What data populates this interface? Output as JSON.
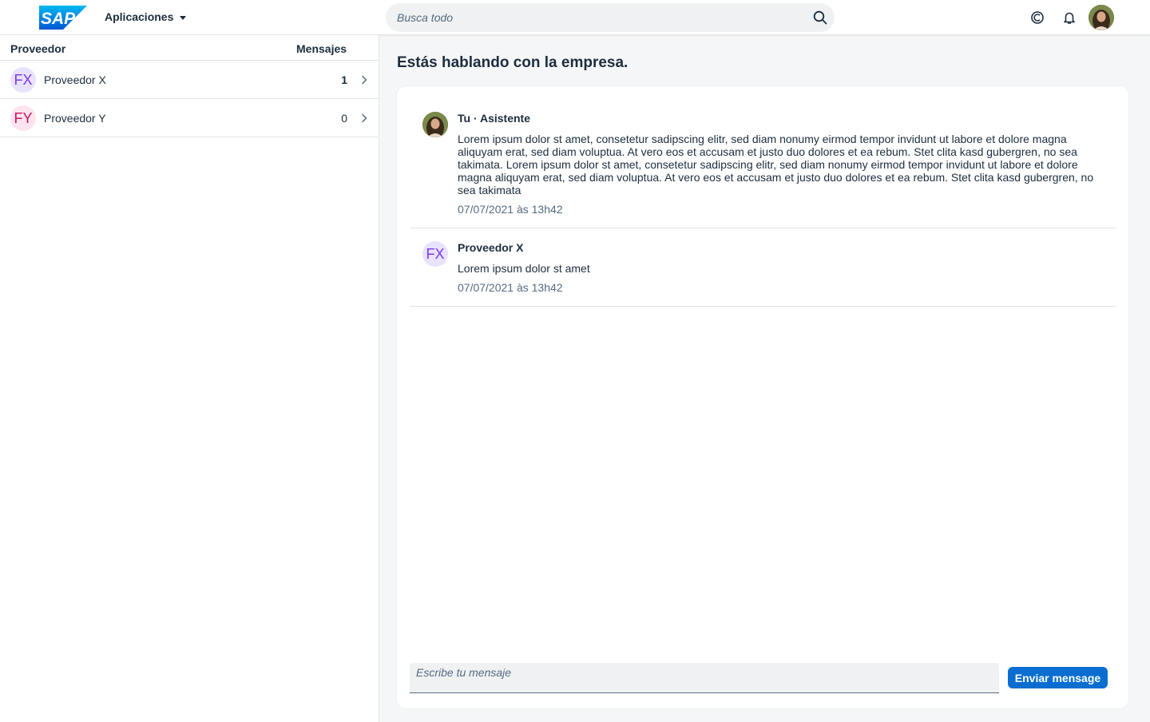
{
  "header": {
    "logo_text": "SAP",
    "apps_label": "Aplicaciones",
    "search_placeholder": "Busca todo",
    "icons": [
      "search-icon",
      "copilot-icon",
      "bell-icon",
      "user-avatar"
    ]
  },
  "sidebar": {
    "col_provider": "Proveedor",
    "col_messages": "Mensajes",
    "rows": [
      {
        "initials": "FX",
        "name": "Proveedor X",
        "count": "1",
        "unread": true,
        "avatar_bg": "#e8e2fd",
        "avatar_fg": "#7c3aed"
      },
      {
        "initials": "FY",
        "name": "Proveedor Y",
        "count": "0",
        "unread": false,
        "avatar_bg": "#fde4ee",
        "avatar_fg": "#c8155d"
      }
    ]
  },
  "chat": {
    "title": "Estás hablando con la empresa.",
    "messages": [
      {
        "author": "Tu · Asistente",
        "text": "Lorem ipsum dolor st amet, consetetur sadipscing elitr, sed diam nonumy eirmod tempor invidunt ut labore et dolore magna aliquyam erat, sed diam voluptua. At vero eos et accusam et justo duo dolores et ea rebum. Stet clita kasd gubergren, no sea takimata. Lorem ipsum dolor st amet, consetetur sadipscing elitr, sed diam nonumy eirmod tempor invidunt ut labore et dolore magna aliquyam erat, sed diam voluptua. At vero eos et accusam et justo duo dolores et ea rebum. Stet clita kasd gubergren, no sea takimata",
        "time": "07/07/2021 às 13h42"
      },
      {
        "author": "Proveedor X",
        "initials": "FX",
        "text": "Lorem ipsum dolor st amet",
        "time": "07/07/2021 às 13h42"
      }
    ],
    "input_placeholder": "Escribe tu mensaje",
    "send_label": "Enviar mensage"
  },
  "colors": {
    "brand": "#0a6ed1",
    "text": "#1d2d3e",
    "muted": "#556b82"
  }
}
